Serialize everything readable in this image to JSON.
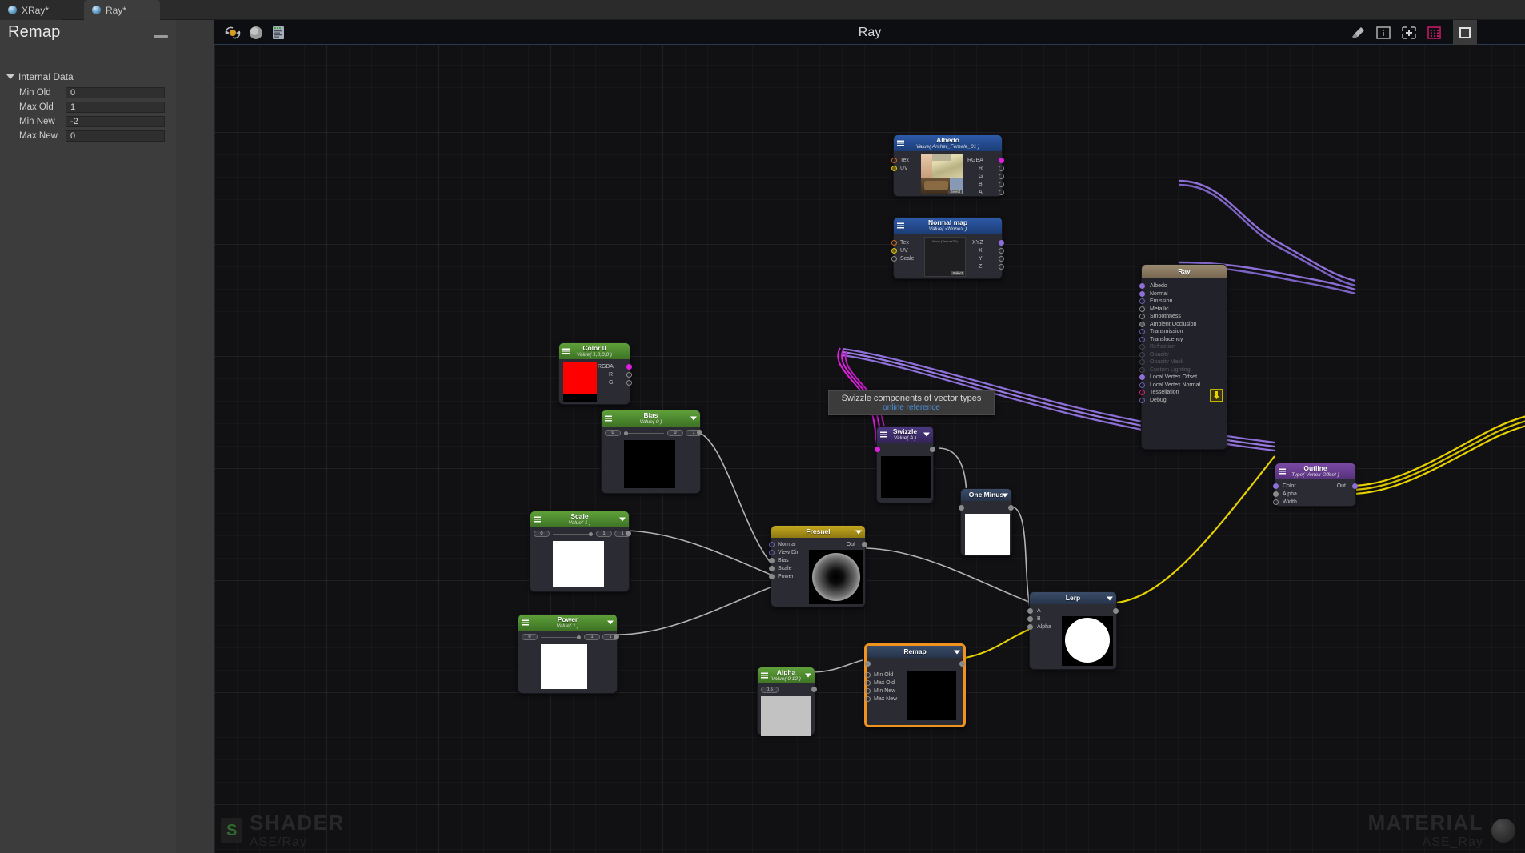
{
  "tabs": [
    {
      "label": "XRay*",
      "active": false
    },
    {
      "label": "Ray*",
      "active": true
    }
  ],
  "inspector": {
    "title": "Remap",
    "minimize_icon": "minimize-icon",
    "foldout": "Internal Data",
    "properties": [
      {
        "label": "Min Old",
        "value": "0"
      },
      {
        "label": "Max Old",
        "value": "1"
      },
      {
        "label": "Min New",
        "value": "-2"
      },
      {
        "label": "Max New",
        "value": "0"
      }
    ]
  },
  "canvas": {
    "title": "Ray",
    "left_icons": [
      "refresh-material-icon",
      "sphere-preview-icon",
      "shader-code-icon"
    ],
    "right_icons": [
      "broom-clean-icon",
      "info-icon",
      "add-node-icon",
      "grid-toggle-icon",
      "focus-icon"
    ],
    "watermark_shader": {
      "big": "SHADER",
      "small": "ASE/Ray"
    },
    "watermark_material": {
      "big": "MATERIAL",
      "small": "ASE_Ray"
    }
  },
  "tooltip": {
    "text": "Swizzle components of vector types",
    "link": "online reference"
  },
  "nodes": {
    "albedo": {
      "title": "Albedo",
      "subtitle": "Value( Archer_Female_01 )",
      "inputs": [
        "Tex",
        "UV"
      ],
      "outputs": [
        "RGBA",
        "R",
        "G",
        "B",
        "A"
      ],
      "select_label": "Select"
    },
    "normalmap": {
      "title": "Normal map",
      "subtitle": "Value( <None> )",
      "inputs": [
        "Tex",
        "UV",
        "Scale"
      ],
      "outputs": [
        "XYZ",
        "X",
        "Y",
        "Z"
      ],
      "preview_label": "None (Texture2D)",
      "select_label": "Select"
    },
    "ray_master": {
      "title": "Ray",
      "ports": [
        {
          "label": "Albedo",
          "connected": true,
          "disabled": false
        },
        {
          "label": "Normal",
          "connected": true,
          "disabled": false
        },
        {
          "label": "Emission",
          "connected": false,
          "disabled": false
        },
        {
          "label": "Metallic",
          "connected": false,
          "disabled": false
        },
        {
          "label": "Smoothness",
          "connected": false,
          "disabled": false
        },
        {
          "label": "Ambient Occlusion",
          "connected": false,
          "disabled": false
        },
        {
          "label": "Transmission",
          "connected": false,
          "disabled": false
        },
        {
          "label": "Translucency",
          "connected": false,
          "disabled": false
        },
        {
          "label": "Refraction",
          "connected": false,
          "disabled": true
        },
        {
          "label": "Opacity",
          "connected": false,
          "disabled": true
        },
        {
          "label": "Opacity Mask",
          "connected": false,
          "disabled": true
        },
        {
          "label": "Custom Lighting",
          "connected": false,
          "disabled": true
        },
        {
          "label": "Local Vertex Offset",
          "connected": true,
          "disabled": false
        },
        {
          "label": "Local Vertex Normal",
          "connected": false,
          "disabled": false
        },
        {
          "label": "Tessellation",
          "connected": false,
          "disabled": false
        },
        {
          "label": "Debug",
          "connected": false,
          "disabled": false
        }
      ],
      "save_icon": "save-download-icon"
    },
    "color0": {
      "title": "Color 0",
      "subtitle": "Value( 1,0,0,0 )",
      "outputs": [
        "RGBA",
        "R",
        "G"
      ],
      "swatch_color": "#ff0000"
    },
    "swizzle": {
      "title": "Swizzle",
      "subtitle": "Value( A )"
    },
    "bias": {
      "title": "Bias",
      "subtitle": "Value( 0 )",
      "fields": [
        "0",
        "0",
        "1"
      ]
    },
    "scale": {
      "title": "Scale",
      "subtitle": "Value( 1 )",
      "fields": [
        "0",
        "1",
        "1"
      ]
    },
    "power": {
      "title": "Power",
      "subtitle": "Value( 1 )",
      "fields": [
        "0",
        "1",
        "1"
      ]
    },
    "fresnel": {
      "title": "Fresnel",
      "inputs": [
        "Normal",
        "View Dir",
        "Bias",
        "Scale",
        "Power"
      ],
      "outputs": [
        "Out"
      ]
    },
    "oneminus": {
      "title": "One Minus"
    },
    "alpha": {
      "title": "Alpha",
      "subtitle": "Value( 0.12 )",
      "fields": [
        "0.5"
      ]
    },
    "remap": {
      "title": "Remap",
      "inputs": [
        "Min Old",
        "Max Old",
        "Min New",
        "Max New"
      ],
      "selected": true
    },
    "lerp": {
      "title": "Lerp",
      "inputs": [
        "A",
        "B",
        "Alpha"
      ]
    },
    "outline": {
      "title": "Outline",
      "subtitle": "Type( Vertex Offset )",
      "inputs": [
        "Color",
        "Alpha",
        "Width"
      ],
      "outputs": [
        "Out"
      ]
    }
  },
  "colors": {
    "wire_purple": "#8e6fd8",
    "wire_magenta": "#e01ee0",
    "wire_yellow": "#e8d200",
    "wire_grey": "#b4b4b4",
    "selection": "#f0921e",
    "header_green": "#4f8f2e",
    "header_blue": "#22468f",
    "header_gold": "#a08a1a",
    "header_purple": "#6a3f8f",
    "header_steel": "#2c3b52",
    "header_tan": "#8a7a62"
  }
}
